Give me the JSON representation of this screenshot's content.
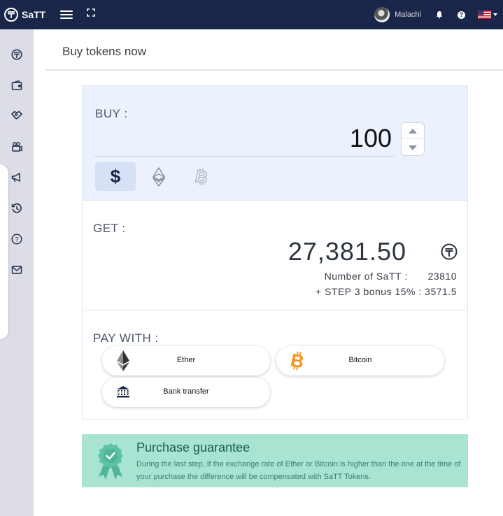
{
  "app": {
    "name": "SaTT"
  },
  "header": {
    "username": "Malachi"
  },
  "page": {
    "title": "Buy tokens now"
  },
  "buy": {
    "label": "BUY :",
    "amount": "100",
    "currencies": [
      {
        "name": "dollar",
        "symbol": "$",
        "active": true
      },
      {
        "name": "ether",
        "active": false
      },
      {
        "name": "bitcoin",
        "active": false
      }
    ]
  },
  "get": {
    "label": "GET :",
    "amount": "27,381.50",
    "number_label": "Number of SaTT :",
    "number_value": "23810",
    "bonus_label": "+ STEP 3 bonus 15% :",
    "bonus_value": "3571.5"
  },
  "pay": {
    "label": "PAY WITH :",
    "options": [
      {
        "label": "Ether",
        "icon": "ether-icon"
      },
      {
        "label": "Bitcoin",
        "icon": "bitcoin-icon"
      },
      {
        "label": "Bank transfer",
        "icon": "bank-icon",
        "icon_text": "BANK"
      }
    ]
  },
  "guarantee": {
    "title": "Purchase guarantee",
    "text": "During the last step, if the exchange rate of Ether or Bitcoin is higher than the one at the time of your purchase the difference will be compensated with SaTT Tokens."
  },
  "colors": {
    "topbar": "#1a2649",
    "sidebar": "#dcdde6",
    "buy_bg": "#ebf1fd",
    "guarantee_bg": "#a9e4d3",
    "guarantee_title": "#165e4e",
    "bitcoin_orange": "#f7931a"
  }
}
